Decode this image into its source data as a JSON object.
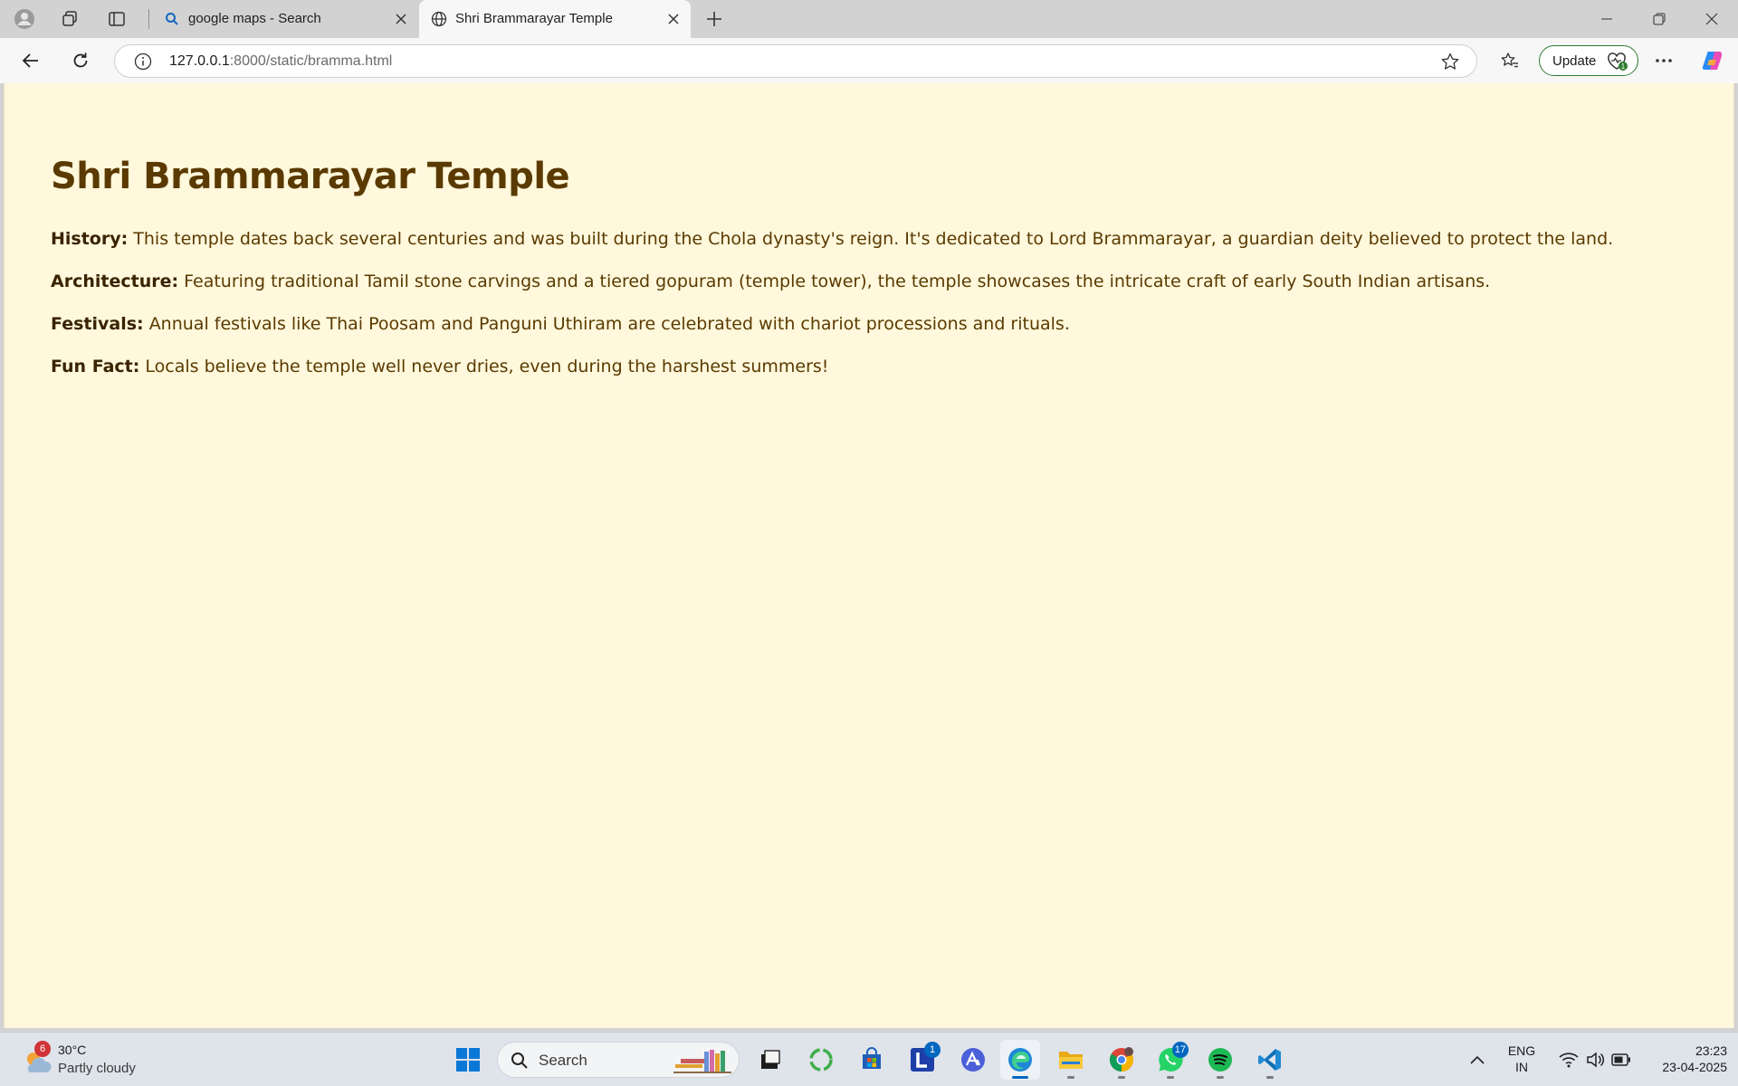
{
  "browser": {
    "tabs": [
      {
        "title": "google maps - Search",
        "active": false
      },
      {
        "title": "Shri Brammarayar Temple",
        "active": true
      }
    ],
    "address": {
      "host": "127.0.0.1",
      "path": ":8000/static/bramma.html"
    },
    "update_label": "Update"
  },
  "page": {
    "title": "Shri Brammarayar Temple",
    "background": "#fff8dc",
    "text_color": "#5a3a00",
    "sections": [
      {
        "label": "History:",
        "text": "This temple dates back several centuries and was built during the Chola dynasty's reign. It's dedicated to Lord Brammarayar, a guardian deity believed to protect the land."
      },
      {
        "label": "Architecture:",
        "text": "Featuring traditional Tamil stone carvings and a tiered gopuram (temple tower), the temple showcases the intricate craft of early South Indian artisans."
      },
      {
        "label": "Festivals:",
        "text": "Annual festivals like Thai Poosam and Panguni Uthiram are celebrated with chariot processions and rituals."
      },
      {
        "label": "Fun Fact:",
        "text": "Locals believe the temple well never dries, even during the harshest summers!"
      }
    ]
  },
  "taskbar": {
    "weather": {
      "temp": "30°C",
      "condition": "Partly cloudy",
      "badge": "6"
    },
    "search_label": "Search",
    "badges": {
      "lens": "1",
      "whatsapp": "17"
    },
    "language": {
      "line1": "ENG",
      "line2": "IN"
    },
    "time": "23:23",
    "date": "23-04-2025"
  }
}
